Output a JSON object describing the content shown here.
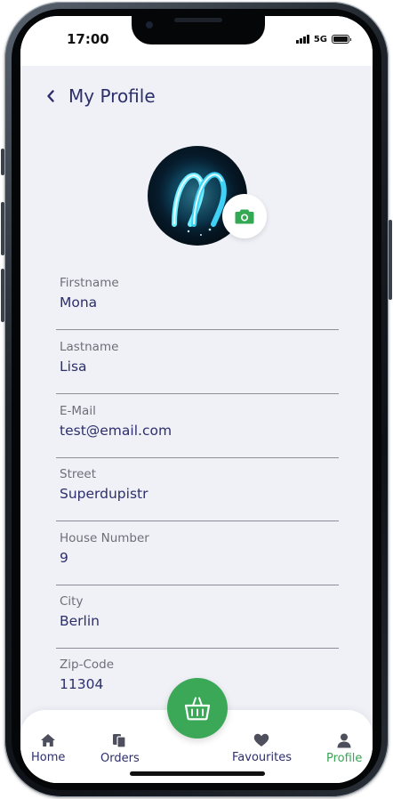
{
  "status_bar": {
    "time": "17:00",
    "network": "5G"
  },
  "header": {
    "title": "My Profile"
  },
  "fields": [
    {
      "label": "Firstname",
      "value": "Mona"
    },
    {
      "label": "Lastname",
      "value": "Lisa"
    },
    {
      "label": "E-Mail",
      "value": "test@email.com"
    },
    {
      "label": "Street",
      "value": "Superdupistr"
    },
    {
      "label": "House Number",
      "value": "9"
    },
    {
      "label": "City",
      "value": "Berlin"
    },
    {
      "label": "Zip-Code",
      "value": "11304"
    }
  ],
  "nav": {
    "items": [
      {
        "label": "Home",
        "icon": "home-icon"
      },
      {
        "label": "Orders",
        "icon": "orders-icon"
      },
      {
        "label": "Favourites",
        "icon": "heart-icon"
      },
      {
        "label": "Profile",
        "icon": "person-icon"
      }
    ],
    "active": "Profile",
    "fab_icon": "basket-icon"
  },
  "colors": {
    "accent": "#34a853",
    "title": "#2c2f6b",
    "background": "#f0f1f7"
  }
}
